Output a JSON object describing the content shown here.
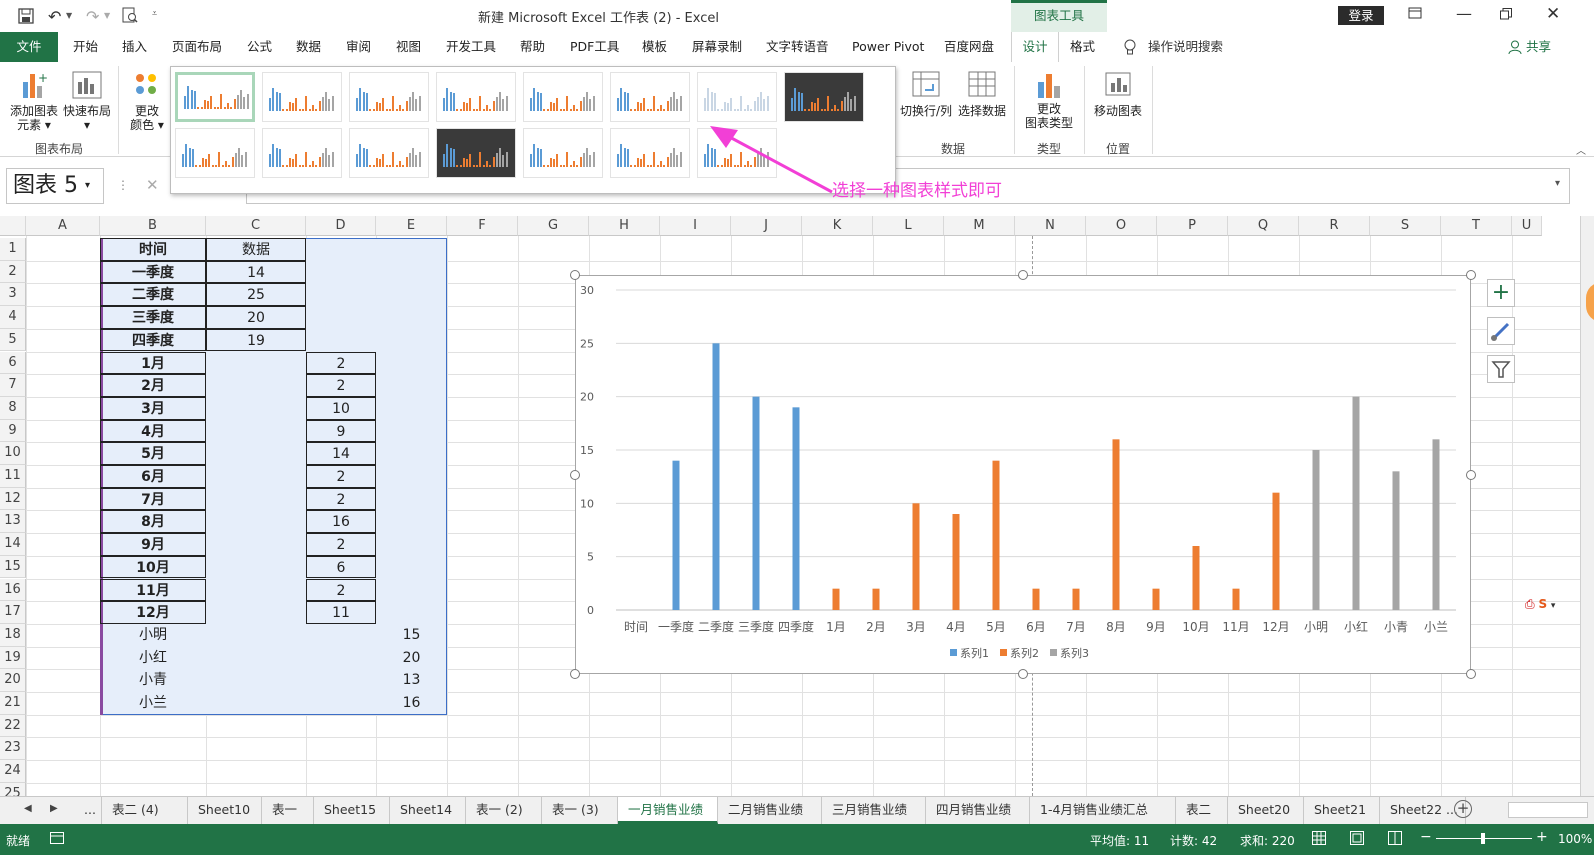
{
  "title": {
    "doc": "新建 Microsoft Excel 工作表 (2)",
    "sep": "-",
    "app": "Excel",
    "context_group": "图表工具",
    "login": "登录"
  },
  "tabs": [
    "文件",
    "开始",
    "插入",
    "页面布局",
    "公式",
    "数据",
    "审阅",
    "视图",
    "开发工具",
    "帮助",
    "PDF工具",
    "模板",
    "屏幕录制",
    "文字转语音",
    "Power Pivot",
    "百度网盘",
    "设计",
    "格式"
  ],
  "tell_me": "操作说明搜索",
  "share": "共享",
  "ribbon": {
    "add_element": [
      "添加图表",
      "元素"
    ],
    "quick_layout": "快速布局",
    "layout_group": "图表布局",
    "change_colors": [
      "更改",
      "颜色"
    ],
    "switch_row_col": "切换行/列",
    "select_data": "选择数据",
    "data_group": "数据",
    "change_type": [
      "更改",
      "图表类型"
    ],
    "type_group": "类型",
    "move_chart": "移动图表",
    "location_group": "位置"
  },
  "annotation": "选择一种图表样式即可",
  "name_box": "图表 5",
  "columns": [
    "A",
    "B",
    "C",
    "D",
    "E",
    "F",
    "G",
    "H",
    "I",
    "J",
    "K",
    "L",
    "M",
    "N",
    "O",
    "P",
    "Q",
    "R",
    "S",
    "T",
    "U"
  ],
  "rows": [
    "1",
    "2",
    "3",
    "4",
    "5",
    "6",
    "7",
    "8",
    "9",
    "10",
    "11",
    "12",
    "13",
    "14",
    "15",
    "16",
    "17",
    "18",
    "19",
    "20",
    "21",
    "22",
    "23",
    "24",
    "25"
  ],
  "table": {
    "headers": [
      "时间",
      "数据"
    ],
    "b": [
      "一季度",
      "二季度",
      "三季度",
      "四季度",
      "1月",
      "2月",
      "3月",
      "4月",
      "5月",
      "6月",
      "7月",
      "8月",
      "9月",
      "10月",
      "11月",
      "12月",
      "小明",
      "小红",
      "小青",
      "小兰"
    ],
    "c": [
      "14",
      "25",
      "20",
      "19"
    ],
    "d": [
      "2",
      "2",
      "10",
      "9",
      "14",
      "2",
      "2",
      "16",
      "2",
      "6",
      "2",
      "11"
    ],
    "e": [
      "15",
      "20",
      "13",
      "16"
    ]
  },
  "chart_data": {
    "type": "bar",
    "categories": [
      "时间",
      "一季度",
      "二季度",
      "三季度",
      "四季度",
      "1月",
      "2月",
      "3月",
      "4月",
      "5月",
      "6月",
      "7月",
      "8月",
      "9月",
      "10月",
      "11月",
      "12月",
      "小明",
      "小红",
      "小青",
      "小兰"
    ],
    "series": [
      {
        "name": "系列1",
        "color": "#5b9bd5",
        "values": [
          null,
          14,
          25,
          20,
          19,
          null,
          null,
          null,
          null,
          null,
          null,
          null,
          null,
          null,
          null,
          null,
          null,
          null,
          null,
          null,
          null
        ]
      },
      {
        "name": "系列2",
        "color": "#ed7d31",
        "values": [
          null,
          null,
          null,
          null,
          null,
          2,
          2,
          10,
          9,
          14,
          2,
          2,
          16,
          2,
          6,
          2,
          11,
          null,
          null,
          null,
          null
        ]
      },
      {
        "name": "系列3",
        "color": "#a5a5a5",
        "values": [
          null,
          null,
          null,
          null,
          null,
          null,
          null,
          null,
          null,
          null,
          null,
          null,
          null,
          null,
          null,
          null,
          null,
          15,
          20,
          13,
          16
        ]
      }
    ],
    "ylim": [
      0,
      30
    ],
    "yticks": [
      "0",
      "5",
      "10",
      "15",
      "20",
      "25",
      "30"
    ],
    "grid": true,
    "legend": "bottom"
  },
  "sheets": [
    "...",
    "表二 (4)",
    "Sheet10",
    "表一",
    "Sheet15",
    "Sheet14",
    "表一 (2)",
    "表一 (3)",
    "一月销售业绩",
    "二月销售业绩",
    "三月销售业绩",
    "四月销售业绩",
    "1-4月销售业绩汇总",
    "表二",
    "Sheet20",
    "Sheet21",
    "Sheet22 ..."
  ],
  "active_sheet": "一月销售业绩",
  "status": {
    "ready": "就绪",
    "average": "平均值: 11",
    "count": "计数: 42",
    "sum": "求和: 220",
    "zoom": "100%"
  }
}
